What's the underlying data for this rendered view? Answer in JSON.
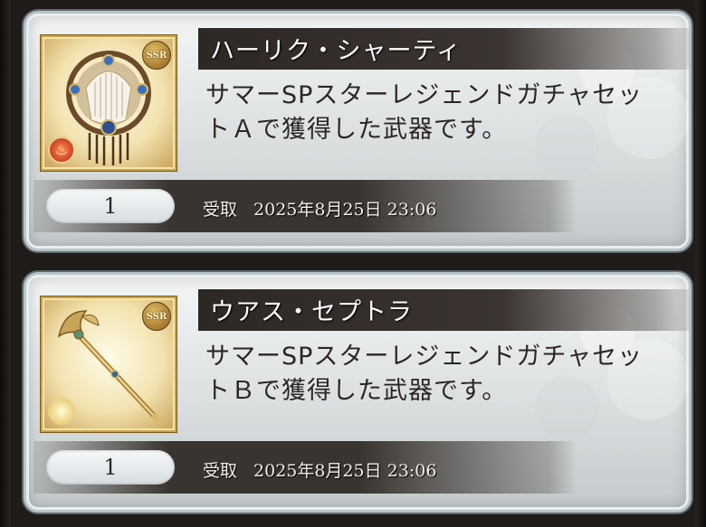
{
  "items": [
    {
      "name": "ハーリク・シャーティ",
      "description": "サマーSPスターレジェンドガチャセットＡで獲得した武器です。",
      "rarity": "SSR",
      "element": "fire",
      "element_icon": "fire-element-icon",
      "quantity": "1",
      "received_label": "受取",
      "received_date": "2025年8月25日 23:06"
    },
    {
      "name": "ウアス・セプトラ",
      "description": "サマーSPスターレジェンドガチャセットＢで獲得した武器です。",
      "rarity": "SSR",
      "element": "light",
      "element_icon": "light-element-icon",
      "quantity": "1",
      "received_label": "受取",
      "received_date": "2025年8月25日 23:06"
    }
  ],
  "colors": {
    "name_bar": "#3b3430",
    "card_border": "#b9c4c9",
    "rarity_gold": "#c9a24b"
  }
}
